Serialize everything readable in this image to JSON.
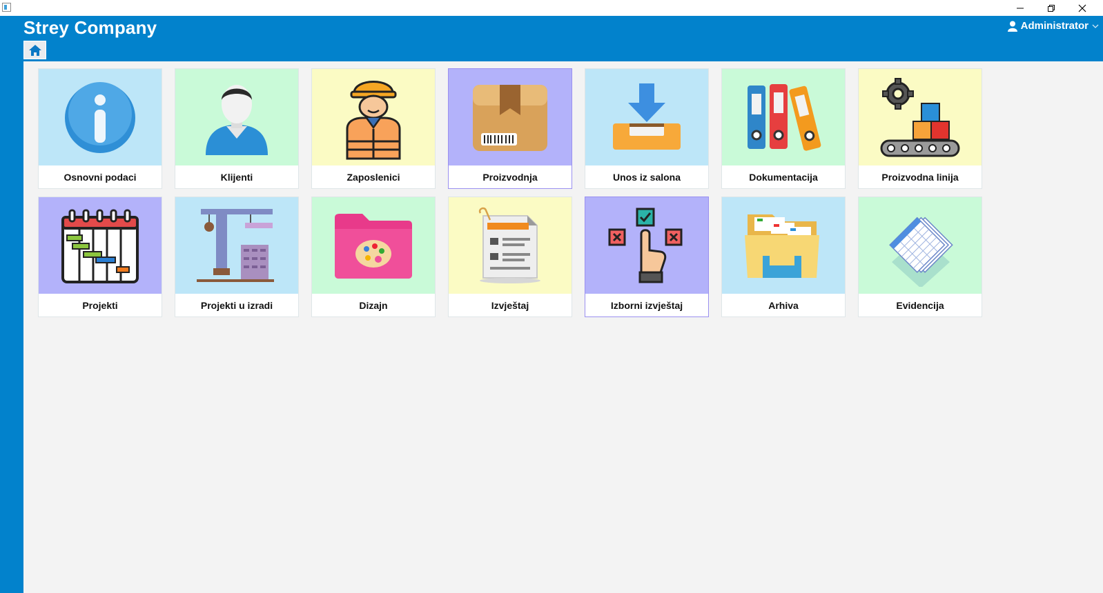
{
  "window": {
    "minimize": "minimize",
    "restore": "restore",
    "close": "close"
  },
  "header": {
    "title": "Strey Company",
    "user": "Administrator"
  },
  "tiles": [
    {
      "label": "Osnovni podaci",
      "icon": "info-icon",
      "bg": "blue"
    },
    {
      "label": "Klijenti",
      "icon": "client-person-icon",
      "bg": "green"
    },
    {
      "label": "Zaposlenici",
      "icon": "worker-icon",
      "bg": "yellow"
    },
    {
      "label": "Proizvodnja",
      "icon": "box-icon",
      "bg": "purple"
    },
    {
      "label": "Unos iz salona",
      "icon": "tray-download-icon",
      "bg": "blue"
    },
    {
      "label": "Dokumentacija",
      "icon": "binders-icon",
      "bg": "green"
    },
    {
      "label": "Proizvodna linija",
      "icon": "conveyor-icon",
      "bg": "yellow"
    },
    {
      "label": "Projekti",
      "icon": "gantt-calendar-icon",
      "bg": "purple"
    },
    {
      "label": "Projekti u izradi",
      "icon": "crane-icon",
      "bg": "blue"
    },
    {
      "label": "Dizajn",
      "icon": "palette-folder-icon",
      "bg": "green"
    },
    {
      "label": "Izvještaj",
      "icon": "report-icon",
      "bg": "yellow"
    },
    {
      "label": "Izborni izvještaj",
      "icon": "choice-hand-icon",
      "bg": "purple"
    },
    {
      "label": "Arhiva",
      "icon": "archive-folder-icon",
      "bg": "blue"
    },
    {
      "label": "Evidencija",
      "icon": "spreadsheet-stack-icon",
      "bg": "green"
    }
  ]
}
